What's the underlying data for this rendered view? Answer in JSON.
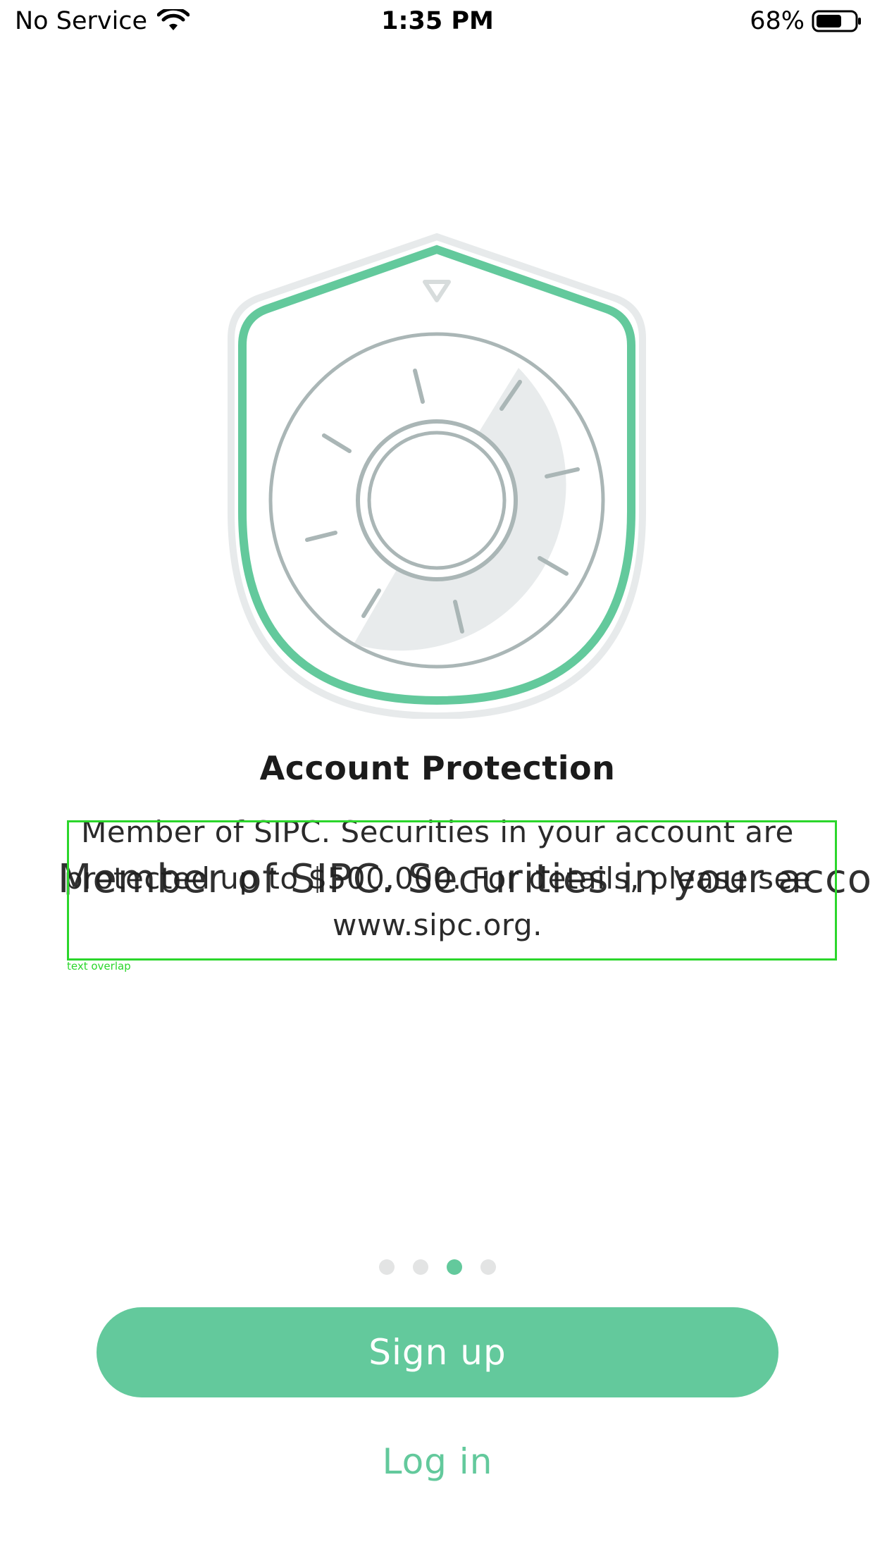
{
  "status_bar": {
    "carrier": "No Service",
    "time": "1:35 PM",
    "battery_percent": "68%",
    "battery_level": 0.68,
    "icons": [
      "wifi-icon",
      "battery-icon"
    ]
  },
  "onboarding": {
    "illustration": "shield-safe-dial-icon",
    "title": "Account Protection",
    "description": "Member of SIPC. Securities in your account are protected up to $500,000. For details, please see www.sipc.org.",
    "overlay_text": "Member of SIPC. Securities in your account are",
    "overlap_label": "text overlap",
    "pager": {
      "total": 4,
      "active_index": 2
    }
  },
  "actions": {
    "signup_label": "Sign up",
    "login_label": "Log in"
  },
  "colors": {
    "accent": "#63c99c",
    "dot_inactive": "#e3e4e4",
    "dial_stroke": "#aab6b6",
    "debug_box": "#2bd62b"
  }
}
